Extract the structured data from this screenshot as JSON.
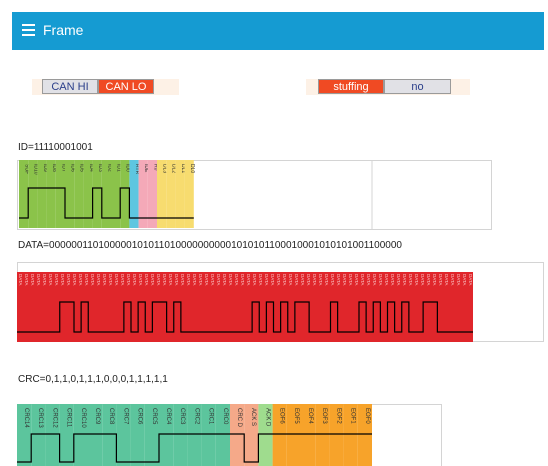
{
  "appbar": {
    "title": "Frame",
    "menu_icon": "hamburger-menu-icon",
    "color": "#159bd2"
  },
  "line_toggle": {
    "options": [
      "CAN HI",
      "CAN LO"
    ],
    "selected": "CAN LO"
  },
  "stuffing_toggle": {
    "options": [
      "stuffing",
      "no"
    ],
    "selected": "stuffing"
  },
  "id_label": "ID=11110001001",
  "data_label": "DATA=0000001101000001010110100000000001010101100010001010101001100000",
  "crc_label": "CRC=0,1,1,0,1,1,1,0,0,0,1,1,1,1,1",
  "id_fields": [
    "SOF",
    "ID10",
    "ID9",
    "ID8",
    "ID7",
    "ID6",
    "ID5",
    "ID4",
    "ID3",
    "ID2",
    "ID1",
    "ID0",
    "RTR",
    "IDE",
    "R0",
    "DL3",
    "DL2",
    "DL1",
    "DL0"
  ],
  "crc_fields": [
    "CRC14",
    "CRC13",
    "CRC12",
    "CRC11",
    "CRC10",
    "CRC9",
    "CRC8",
    "CRC7",
    "CRC6",
    "CRC5",
    "CRC4",
    "CRC3",
    "CRC2",
    "CRC1",
    "CRC0",
    "CRC D",
    "ACK S",
    "ACK D",
    "EOF6",
    "EOF5",
    "EOF4",
    "EOF3",
    "EOF2",
    "EOF1",
    "EOF0"
  ],
  "colors": {
    "id": "#8bc34a",
    "rtr": "#5ec6e0",
    "control": "#f4a9b8",
    "dlc": "#f7dc6f",
    "data": "#e0262b",
    "crc": "#5cc59d",
    "delim": "#f5a989",
    "ack": "#9fdc8e",
    "eof": "#f7a32a",
    "toggle_on": "#f04a23",
    "toggle_off": "#e1e1e6"
  }
}
